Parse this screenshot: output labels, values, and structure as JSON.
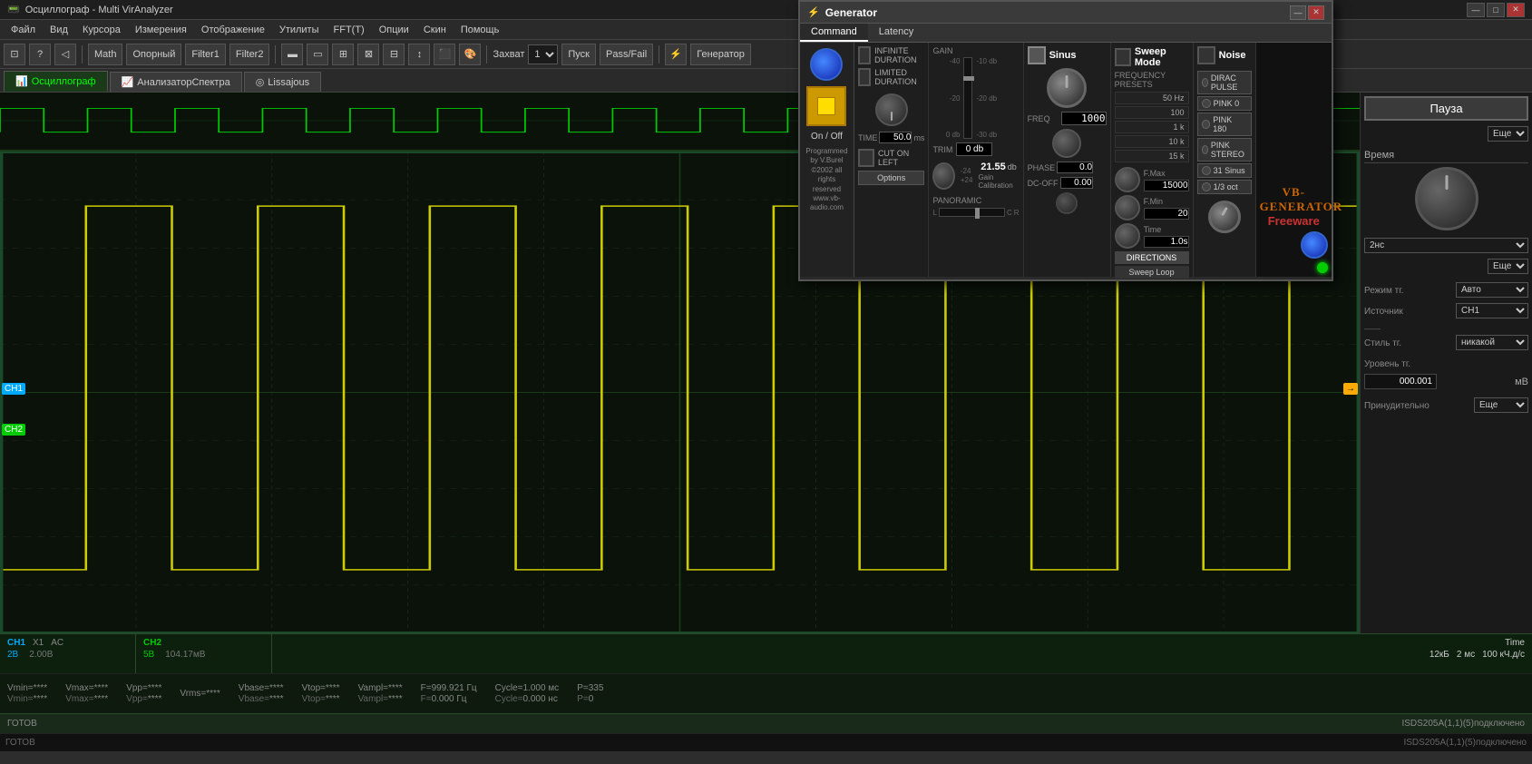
{
  "app": {
    "title": "Осциллограф - Multi VirAnalyzer",
    "window_controls": [
      "—",
      "□",
      "✕"
    ]
  },
  "menubar": {
    "items": [
      "Файл",
      "Вид",
      "Курсора",
      "Измерения",
      "Отображение",
      "Утилиты",
      "FFT(T)",
      "Опции",
      "Скин",
      "Помощь"
    ]
  },
  "toolbar": {
    "math_label": "Math",
    "oporniy_label": "Опорный",
    "filter1_label": "Filter1",
    "filter2_label": "Filter2",
    "zahvat_label": "Захват",
    "zahvat_val": "1",
    "pusk_label": "Пуск",
    "passfail_label": "Pass/Fail",
    "generator_label": "Генератор"
  },
  "tabs": [
    {
      "id": "osc",
      "label": "Осциллограф",
      "active": true,
      "icon": "📊"
    },
    {
      "id": "spec",
      "label": "АнализаторСпектра",
      "active": false,
      "icon": "📈"
    },
    {
      "id": "lis",
      "label": "Lissajous",
      "active": false,
      "icon": "◎"
    }
  ],
  "generator": {
    "title": "Generator",
    "tabs": [
      "Command",
      "Latency"
    ],
    "active_tab": "Command",
    "on_off_label": "On / Off",
    "on_off_active": true,
    "info_text": "Programmed by V.Burel\n©2002 all rights reserved\nwww.vb-audio.com",
    "infinite_duration_label": "INFINITE DURATION",
    "limited_duration_label": "LIMITED DURATION",
    "time_label": "TIME",
    "time_value": "50.0",
    "time_unit": "ms",
    "trim_label": "TRIM",
    "trim_value": "0 db",
    "gain_calibration_value": "21.55",
    "gain_calibration_label": "Gain Calibration",
    "cut_on_left_label": "CUT ON LEFT",
    "options_label": "Options",
    "panoramic_label": "PANORAMIC",
    "panoramic_labels": [
      "L",
      "C",
      "R"
    ],
    "sinus_label": "Sinus",
    "gain_label": "GAIN",
    "gain_scale": [
      "-40",
      "-20",
      "0 db",
      "-10 db",
      "-20 db",
      "-30 db"
    ],
    "freq_label": "FREQ",
    "freq_value": "1000",
    "phase_label": "PHASE",
    "phase_value": "0.0",
    "dcoff_label": "DC-OFF",
    "dcoff_value": "0.00",
    "sweep_label": "Sweep Mode",
    "freq_presets_label": "FREQUENCY PRESETS",
    "freq_presets": [
      "50 Hz",
      "100",
      "1 k",
      "10 k",
      "15 k"
    ],
    "fmax_label": "F.Max",
    "fmax_value": "15000",
    "fmin_label": "F.Min",
    "fmin_value": "20",
    "time_sweep_label": "Time",
    "time_sweep_value": "1.0s",
    "directions_label": "DIRECTIONS",
    "sweep_loop_label": "Sweep Loop",
    "noise_label": "Noise",
    "dirac_pulse_label": "DIRAC PULSE",
    "pink0_label": "PINK 0",
    "pink180_label": "PINK 180",
    "pink_stereo_label": "PINK STEREO",
    "sinus31_label": "31 Sinus",
    "onethird_label": "1/3 oct",
    "vb_brand": "VB-GENERATOR",
    "vb_sub": "Freeware"
  },
  "right_panel": {
    "pause_label": "Пауза",
    "esche_label": "Еще",
    "time_label": "Время",
    "time_select": "2нс",
    "esche2_label": "Еще",
    "trig_mode_label": "Режим тг.",
    "trig_mode_val": "Авто",
    "source_label": "Источник",
    "source_val": "CH1",
    "style_label": "Стиль тг.",
    "style_val": "никакой",
    "level_label": "Уровень тг.",
    "level_val": "000.001",
    "level_unit": "мВ",
    "force_label": "Принудительно",
    "force_esche": "Еще"
  },
  "ch_info": {
    "ch1_label": "CH1",
    "ch1_x": "X1",
    "ch1_ac": "AC",
    "ch1_v": "2В",
    "ch1_vbase": "2.00В",
    "ch2_label": "CH2",
    "ch2_v": "5В",
    "ch2_vbase": "104.17мВ",
    "time_label": "Time",
    "time_val": "2 мс",
    "time_rate": "100 кЧ.д/с",
    "time_kb": "12кБ"
  },
  "measurements": {
    "ch1": {
      "vmin_label": "Vmin=",
      "vmin_val": "****",
      "vmax_label": "Vmax=",
      "vmax_val": "****",
      "vpp_label": "Vpp=",
      "vpp_val": "****",
      "vrms_label": "Vrms=",
      "vrms_val": "****",
      "vbase_label": "Vbase=",
      "vbase_val": "****",
      "vtop_label": "Vtop=",
      "vtop_val": "****",
      "vampl_label": "Vampl=",
      "vampl_val": "****"
    },
    "freq": {
      "f_label": "F=",
      "f_val": "999.921 Гц",
      "f2_label": "F=",
      "f2_val": "0.000 Гц"
    },
    "cycle": {
      "cycle_label": "Cycle=",
      "cycle_val": "1.000 мс",
      "cycle2_label": "Cycle=",
      "cycle2_val": "0.000 нс"
    },
    "p_label": "P=",
    "p_val": "335",
    "p2_label": "P=",
    "p2_val": "0"
  },
  "status": {
    "left": "ГОТОВ",
    "right": "ISDS205A(1,1)(5)подключено"
  }
}
